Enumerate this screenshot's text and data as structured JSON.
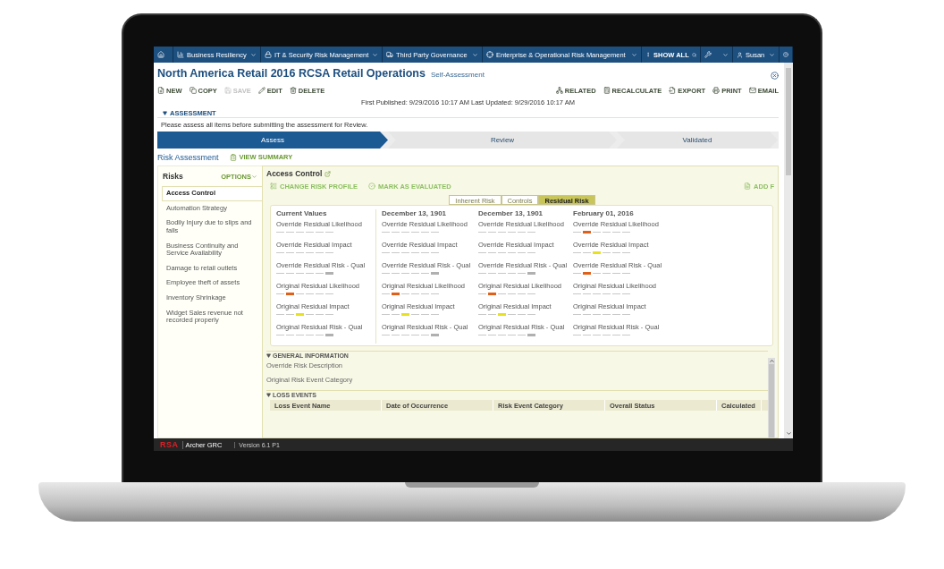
{
  "nav": {
    "items": [
      {
        "kind": "home"
      },
      {
        "kind": "chart",
        "label": "Business Resiliency"
      },
      {
        "kind": "lock",
        "label": "IT & Security Risk Management"
      },
      {
        "kind": "truck",
        "label": "Third Party Governance"
      },
      {
        "kind": "target",
        "label": "Enterprise & Operational Risk Management"
      }
    ],
    "show_all": "SHOW ALL",
    "user": "Susan"
  },
  "title": "North America Retail 2016 RCSA Retail Operations",
  "subtitle": "Self-Assessment",
  "toolbar_left": [
    {
      "kind": "new",
      "label": "NEW",
      "disabled": false
    },
    {
      "kind": "copy",
      "label": "COPY",
      "disabled": false
    },
    {
      "kind": "save",
      "label": "SAVE",
      "disabled": true
    },
    {
      "kind": "edit",
      "label": "EDIT",
      "disabled": false
    },
    {
      "kind": "delete",
      "label": "DELETE",
      "disabled": false
    }
  ],
  "toolbar_right": [
    {
      "kind": "related",
      "label": "RELATED"
    },
    {
      "kind": "calc",
      "label": "RECALCULATE"
    },
    {
      "kind": "export",
      "label": "EXPORT"
    },
    {
      "kind": "print",
      "label": "PRINT"
    },
    {
      "kind": "email",
      "label": "EMAIL"
    }
  ],
  "published": "First Published: 9/29/2016 10:17 AM Last Updated: 9/29/2016 10:17 AM",
  "section": "ASSESSMENT",
  "instructions": "Please assess all items before submitting the assessment for Review.",
  "steps": [
    {
      "label": "Assess",
      "selected": true
    },
    {
      "label": "Review",
      "selected": false
    },
    {
      "label": "Validated",
      "selected": false
    }
  ],
  "risk_assessment": "Risk Assessment",
  "view_summary": "VIEW SUMMARY",
  "risks": {
    "title": "Risks",
    "options": "OPTIONS",
    "items": [
      {
        "label": "Access Control",
        "selected": true
      },
      {
        "label": "Automation Strategy",
        "selected": false
      },
      {
        "label": "Bodily Injury due to slips and falls",
        "selected": false
      },
      {
        "label": "Business Continuity and Service Availability",
        "selected": false
      },
      {
        "label": "Damage to retail outlets",
        "selected": false
      },
      {
        "label": "Employee theft of assets",
        "selected": false
      },
      {
        "label": "Inventory Shrinkage",
        "selected": false
      },
      {
        "label": "Widget Sales revenue not recorded properly",
        "selected": false
      }
    ]
  },
  "detail": {
    "title": "Access Control",
    "actions": [
      {
        "kind": "profile",
        "label": "CHANGE RISK PROFILE"
      },
      {
        "kind": "check",
        "label": "MARK AS EVALUATED"
      }
    ],
    "add": "ADD F",
    "tabs": [
      {
        "label": "Inherent Risk",
        "selected": false
      },
      {
        "label": "Controls",
        "selected": false
      },
      {
        "label": "Residual Risk",
        "selected": true
      }
    ],
    "columns": [
      {
        "heading": "Current Values",
        "metrics": [
          {
            "label": "Override Residual Likelihood",
            "segments": [
              {
                "selected": false
              },
              {
                "selected": false
              },
              {
                "selected": false
              },
              {
                "selected": false
              },
              {
                "selected": false
              },
              {
                "selected": false
              }
            ]
          },
          {
            "label": "Override Residual Impact",
            "segments": [
              {
                "selected": false
              },
              {
                "selected": false
              },
              {
                "selected": false
              },
              {
                "selected": false
              },
              {
                "selected": false
              },
              {
                "selected": false
              }
            ]
          },
          {
            "label": "Override Residual Risk - Qual",
            "segments": [
              {
                "selected": false
              },
              {
                "selected": false
              },
              {
                "selected": false
              },
              {
                "selected": false
              },
              {
                "selected": false
              },
              {
                "selected": true,
                "color": "#b0b0b0"
              }
            ]
          },
          {
            "label": "Original Residual Likelihood",
            "segments": [
              {
                "selected": false
              },
              {
                "selected": true,
                "color": "#e0601a"
              },
              {
                "selected": false
              },
              {
                "selected": false
              },
              {
                "selected": false
              },
              {
                "selected": false
              }
            ]
          },
          {
            "label": "Original Residual Impact",
            "segments": [
              {
                "selected": false
              },
              {
                "selected": false
              },
              {
                "selected": true,
                "color": "#e8e21e"
              },
              {
                "selected": false
              },
              {
                "selected": false
              },
              {
                "selected": false
              }
            ]
          },
          {
            "label": "Original Residual Risk - Qual",
            "segments": [
              {
                "selected": false
              },
              {
                "selected": false
              },
              {
                "selected": false
              },
              {
                "selected": false
              },
              {
                "selected": false
              },
              {
                "selected": true,
                "color": "#b0b0b0"
              }
            ]
          }
        ]
      },
      {
        "heading": "December 13, 1901",
        "metrics": [
          {
            "label": "Override Residual Likelihood",
            "segments": [
              {
                "selected": false
              },
              {
                "selected": false
              },
              {
                "selected": false
              },
              {
                "selected": false
              },
              {
                "selected": false
              },
              {
                "selected": false
              }
            ]
          },
          {
            "label": "Override Residual Impact",
            "segments": [
              {
                "selected": false
              },
              {
                "selected": false
              },
              {
                "selected": false
              },
              {
                "selected": false
              },
              {
                "selected": false
              },
              {
                "selected": false
              }
            ]
          },
          {
            "label": "Override Residual Risk - Qual",
            "segments": [
              {
                "selected": false
              },
              {
                "selected": false
              },
              {
                "selected": false
              },
              {
                "selected": false
              },
              {
                "selected": false
              },
              {
                "selected": true,
                "color": "#b0b0b0"
              }
            ]
          },
          {
            "label": "Original Residual Likelihood",
            "segments": [
              {
                "selected": false
              },
              {
                "selected": true,
                "color": "#e0601a"
              },
              {
                "selected": false
              },
              {
                "selected": false
              },
              {
                "selected": false
              },
              {
                "selected": false
              }
            ]
          },
          {
            "label": "Original Residual Impact",
            "segments": [
              {
                "selected": false
              },
              {
                "selected": false
              },
              {
                "selected": true,
                "color": "#e8e21e"
              },
              {
                "selected": false
              },
              {
                "selected": false
              },
              {
                "selected": false
              }
            ]
          },
          {
            "label": "Original Residual Risk - Qual",
            "segments": [
              {
                "selected": false
              },
              {
                "selected": false
              },
              {
                "selected": false
              },
              {
                "selected": false
              },
              {
                "selected": false
              },
              {
                "selected": true,
                "color": "#b0b0b0"
              }
            ]
          }
        ]
      },
      {
        "heading": "December 13, 1901",
        "metrics": [
          {
            "label": "Override Residual Likelihood",
            "segments": [
              {
                "selected": false
              },
              {
                "selected": false
              },
              {
                "selected": false
              },
              {
                "selected": false
              },
              {
                "selected": false
              },
              {
                "selected": false
              }
            ]
          },
          {
            "label": "Override Residual Impact",
            "segments": [
              {
                "selected": false
              },
              {
                "selected": false
              },
              {
                "selected": false
              },
              {
                "selected": false
              },
              {
                "selected": false
              },
              {
                "selected": false
              }
            ]
          },
          {
            "label": "Override Residual Risk - Qual",
            "segments": [
              {
                "selected": false
              },
              {
                "selected": false
              },
              {
                "selected": false
              },
              {
                "selected": false
              },
              {
                "selected": false
              },
              {
                "selected": true,
                "color": "#b0b0b0"
              }
            ]
          },
          {
            "label": "Original Residual Likelihood",
            "segments": [
              {
                "selected": false
              },
              {
                "selected": true,
                "color": "#e0601a"
              },
              {
                "selected": false
              },
              {
                "selected": false
              },
              {
                "selected": false
              },
              {
                "selected": false
              }
            ]
          },
          {
            "label": "Original Residual Impact",
            "segments": [
              {
                "selected": false
              },
              {
                "selected": false
              },
              {
                "selected": true,
                "color": "#e8e21e"
              },
              {
                "selected": false
              },
              {
                "selected": false
              },
              {
                "selected": false
              }
            ]
          },
          {
            "label": "Original Residual Risk - Qual",
            "segments": [
              {
                "selected": false
              },
              {
                "selected": false
              },
              {
                "selected": false
              },
              {
                "selected": false
              },
              {
                "selected": false
              },
              {
                "selected": true,
                "color": "#b0b0b0"
              }
            ]
          }
        ]
      },
      {
        "heading": "February 01, 2016",
        "metrics": [
          {
            "label": "Override Residual Likelihood",
            "segments": [
              {
                "selected": false
              },
              {
                "selected": true,
                "color": "#e0601a"
              },
              {
                "selected": false
              },
              {
                "selected": false
              },
              {
                "selected": false
              },
              {
                "selected": false
              }
            ]
          },
          {
            "label": "Override Residual Impact",
            "segments": [
              {
                "selected": false
              },
              {
                "selected": false
              },
              {
                "selected": true,
                "color": "#e8e21e"
              },
              {
                "selected": false
              },
              {
                "selected": false
              },
              {
                "selected": false
              }
            ]
          },
          {
            "label": "Override Residual Risk - Qual",
            "segments": [
              {
                "selected": false
              },
              {
                "selected": true,
                "color": "#e0601a"
              },
              {
                "selected": false
              },
              {
                "selected": false
              },
              {
                "selected": false
              },
              {
                "selected": false
              }
            ]
          },
          {
            "label": "Original Residual Likelihood",
            "segments": [
              {
                "selected": false
              },
              {
                "selected": false
              },
              {
                "selected": false
              },
              {
                "selected": false
              },
              {
                "selected": false
              },
              {
                "selected": false
              }
            ]
          },
          {
            "label": "Original Residual Impact",
            "segments": [
              {
                "selected": false
              },
              {
                "selected": false
              },
              {
                "selected": false
              },
              {
                "selected": false
              },
              {
                "selected": false
              },
              {
                "selected": false
              }
            ]
          },
          {
            "label": "Original Residual Risk - Qual",
            "segments": [
              {
                "selected": false
              },
              {
                "selected": false
              },
              {
                "selected": false
              },
              {
                "selected": false
              },
              {
                "selected": false
              },
              {
                "selected": false
              }
            ]
          }
        ]
      }
    ],
    "general": {
      "title": "GENERAL INFORMATION",
      "fields": [
        "Override Risk Description",
        "Original Risk Event Category"
      ]
    },
    "loss_events": {
      "title": "LOSS EVENTS",
      "columns": [
        "Loss Event Name",
        "Date of Occurrence",
        "Risk Event Category",
        "Overall Status",
        "Calculated"
      ]
    }
  },
  "footer": {
    "logo": "RSA",
    "product": "Archer GRC",
    "version": "Version 6.1 P1"
  }
}
